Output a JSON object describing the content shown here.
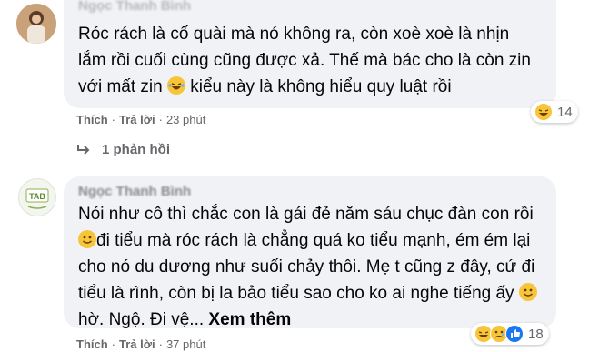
{
  "comments": [
    {
      "author": "Ngọc Thanh Bình",
      "text_parts": [
        "Róc rách là cố quài mà nó không ra, còn xoè xoè là nhịn lắm rồi cuối cùng cũng được xả. Thế mà bác cho là còn zin với mất zin ",
        " kiểu này là không hiểu quy luật rồi"
      ],
      "reaction_icons": [
        "laughing-emoji"
      ],
      "reaction_count": "14",
      "like_label": "Thích",
      "reply_label": "Trả lời",
      "time": "23 phút",
      "replies_label": "1 phản hồi"
    },
    {
      "author": "Ngọc Thanh Bình",
      "text_parts": [
        "Nói như cô thì chắc con là gái đẻ năm sáu chục đàn con rồi",
        "đi tiểu mà róc rách là chẳng quá ko tiểu mạnh, ém ém lại cho nó du dương như suối chảy thôi. Mẹ t cũng z đây, cứ đi tiểu là rình, còn bị la bảo tiểu sao cho ko ai nghe tiếng ấy ",
        " hờ. Ngộ. Đi vệ..."
      ],
      "see_more": "Xem thêm",
      "avatar_text": "TAB",
      "reaction_icons": [
        "laughing-emoji",
        "sad-emoji",
        "like-icon"
      ],
      "reaction_count": "18",
      "like_label": "Thích",
      "reply_label": "Trả lời",
      "time": "37 phút"
    }
  ],
  "colors": {
    "bubble": "#f0f2f5",
    "meta": "#65676b",
    "emoji": "#f7c53a",
    "like": "#1877f2"
  }
}
